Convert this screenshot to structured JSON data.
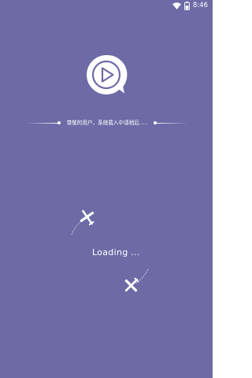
{
  "status_bar": {
    "time": "8:46",
    "icons": [
      "wifi-icon",
      "battery-icon"
    ]
  },
  "splash": {
    "logo_icon": "play-speech-bubble-icon",
    "message": "尊敬的用户，系统载入中请稍后.....",
    "loading_label": "Loading ..."
  },
  "theme": {
    "background": "#6d6aa6",
    "foreground": "#ffffff"
  }
}
